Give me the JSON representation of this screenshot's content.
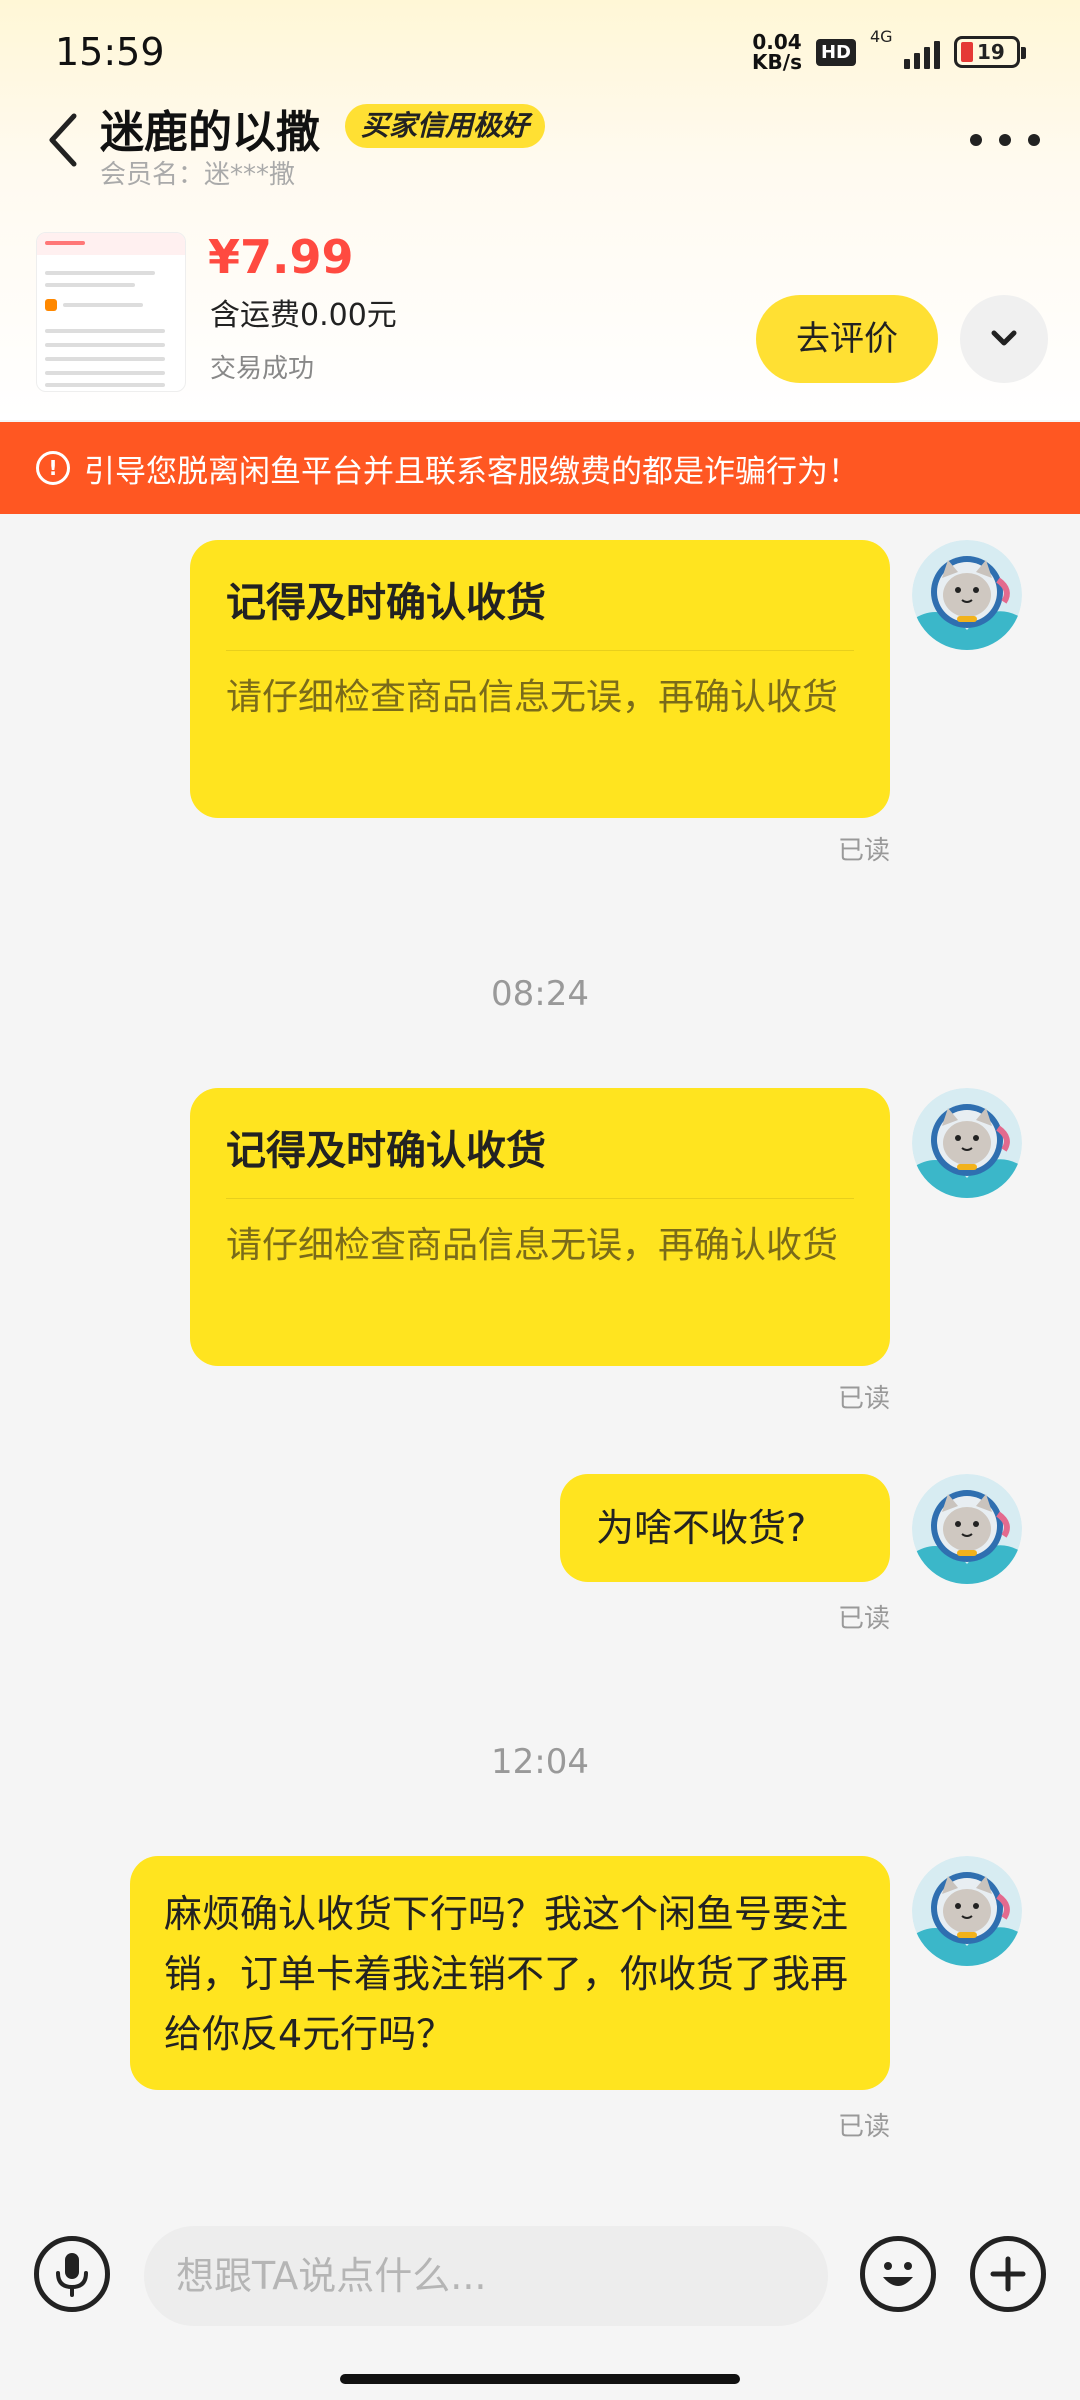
{
  "status_bar": {
    "time": "15:59",
    "net_speed_value": "0.04",
    "net_speed_unit": "KB/s",
    "hd": "HD",
    "network": "4G",
    "battery": "19"
  },
  "header": {
    "title": "迷鹿的以撒",
    "credit_badge": "买家信用极好",
    "member_name": "会员名：迷***撒"
  },
  "order": {
    "price": "¥7.99",
    "shipping": "含运费0.00元",
    "status": "交易成功",
    "review_button": "去评价"
  },
  "warning": {
    "text": "引导您脱离闲鱼平台并且联系客服缴费的都是诈骗行为！"
  },
  "messages": {
    "card1": {
      "title": "记得及时确认收货",
      "desc": "请仔细检查商品信息无误，再确认收货",
      "read": "已读"
    },
    "time1": "08:24",
    "card2": {
      "title": "记得及时确认收货",
      "desc": "请仔细检查商品信息无误，再确认收货",
      "read": "已读"
    },
    "msg1": {
      "text": "为啥不收货?",
      "read": "已读"
    },
    "time2": "12:04",
    "msg2": {
      "text": "麻烦确认收货下行吗？我这个闲鱼号要注销，订单卡着我注销不了，你收货了我再给你反4元行吗？",
      "read": "已读"
    }
  },
  "input_bar": {
    "placeholder": "想跟TA说点什么..."
  },
  "colors": {
    "bubble": "#ffe41f",
    "warning": "#ff5722",
    "price": "#ff4a40"
  }
}
